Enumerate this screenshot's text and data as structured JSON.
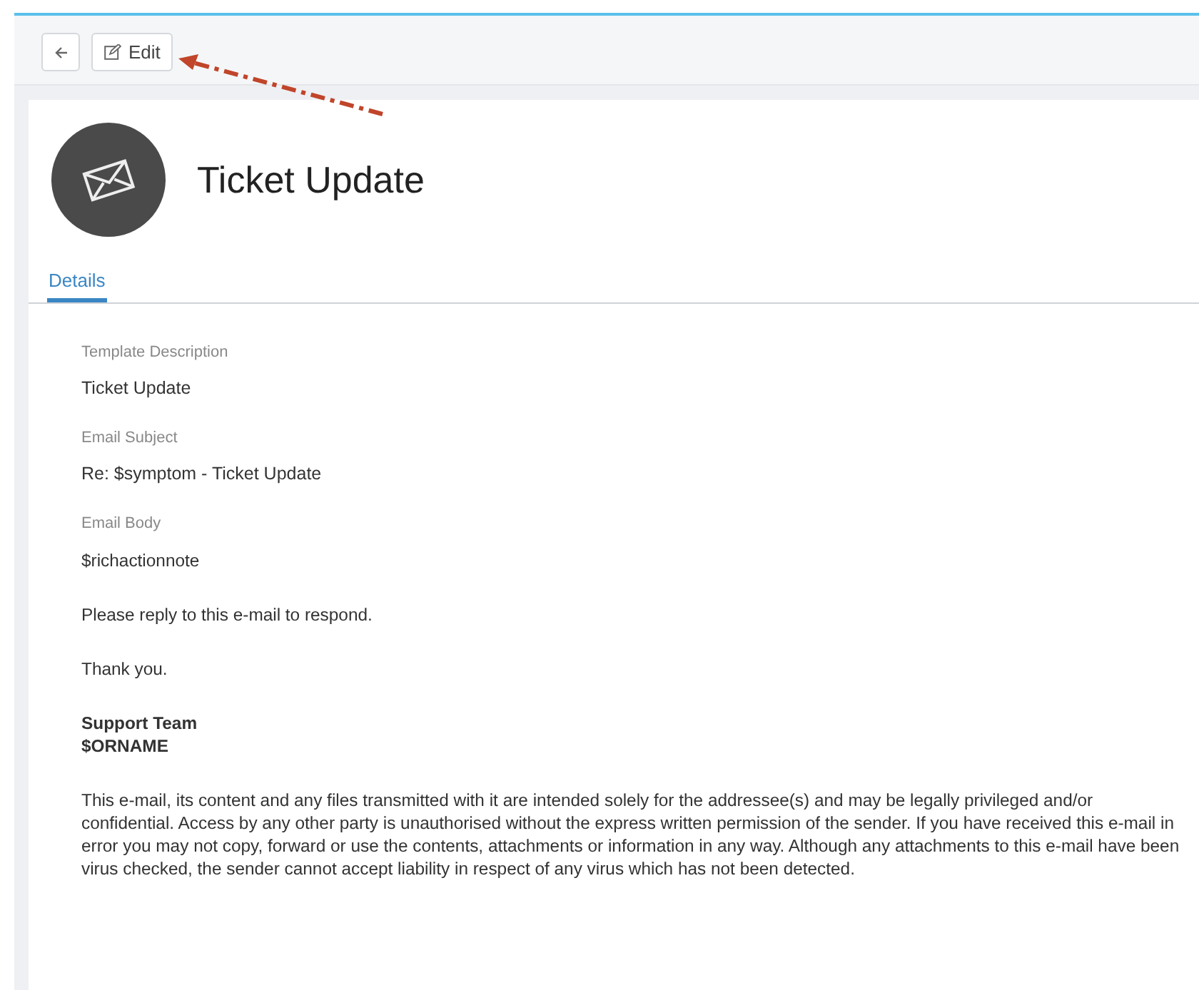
{
  "toolbar": {
    "buttons": [
      {
        "kind": "back"
      },
      {
        "kind": "edit",
        "label": "Edit"
      }
    ]
  },
  "annotation": {
    "kind": "dashed-arrow"
  },
  "header": {
    "title": "Ticket Update"
  },
  "tabs": [
    {
      "label": "Details",
      "selected": true
    }
  ],
  "fields": [
    {
      "label": "Template Description",
      "value": "Ticket Update"
    },
    {
      "label": "Email Subject",
      "value": "Re: $symptom - Ticket Update"
    }
  ],
  "email_body": {
    "label": "Email Body",
    "paragraphs": [
      {
        "kind": "text",
        "lines": [
          "$richactionnote"
        ]
      },
      {
        "kind": "text",
        "lines": [
          "Please reply to this e-mail to respond."
        ]
      },
      {
        "kind": "text",
        "lines": [
          "Thank you."
        ]
      },
      {
        "kind": "signature",
        "lines": [
          "Support Team",
          "$ORNAME"
        ]
      },
      {
        "kind": "text",
        "lines": [
          "This e-mail, its content and any files transmitted with it are intended solely for the addressee(s) and may be legally privileged and/or confidential. Access by any other party is unauthorised without the express written permission of the sender. If you have received this e-mail in error you may not copy, forward or use the contents, attachments or information in any way. Although any attachments to this e-mail have been virus checked, the sender cannot accept liability in respect of any virus which has not been detected."
        ]
      }
    ]
  }
}
